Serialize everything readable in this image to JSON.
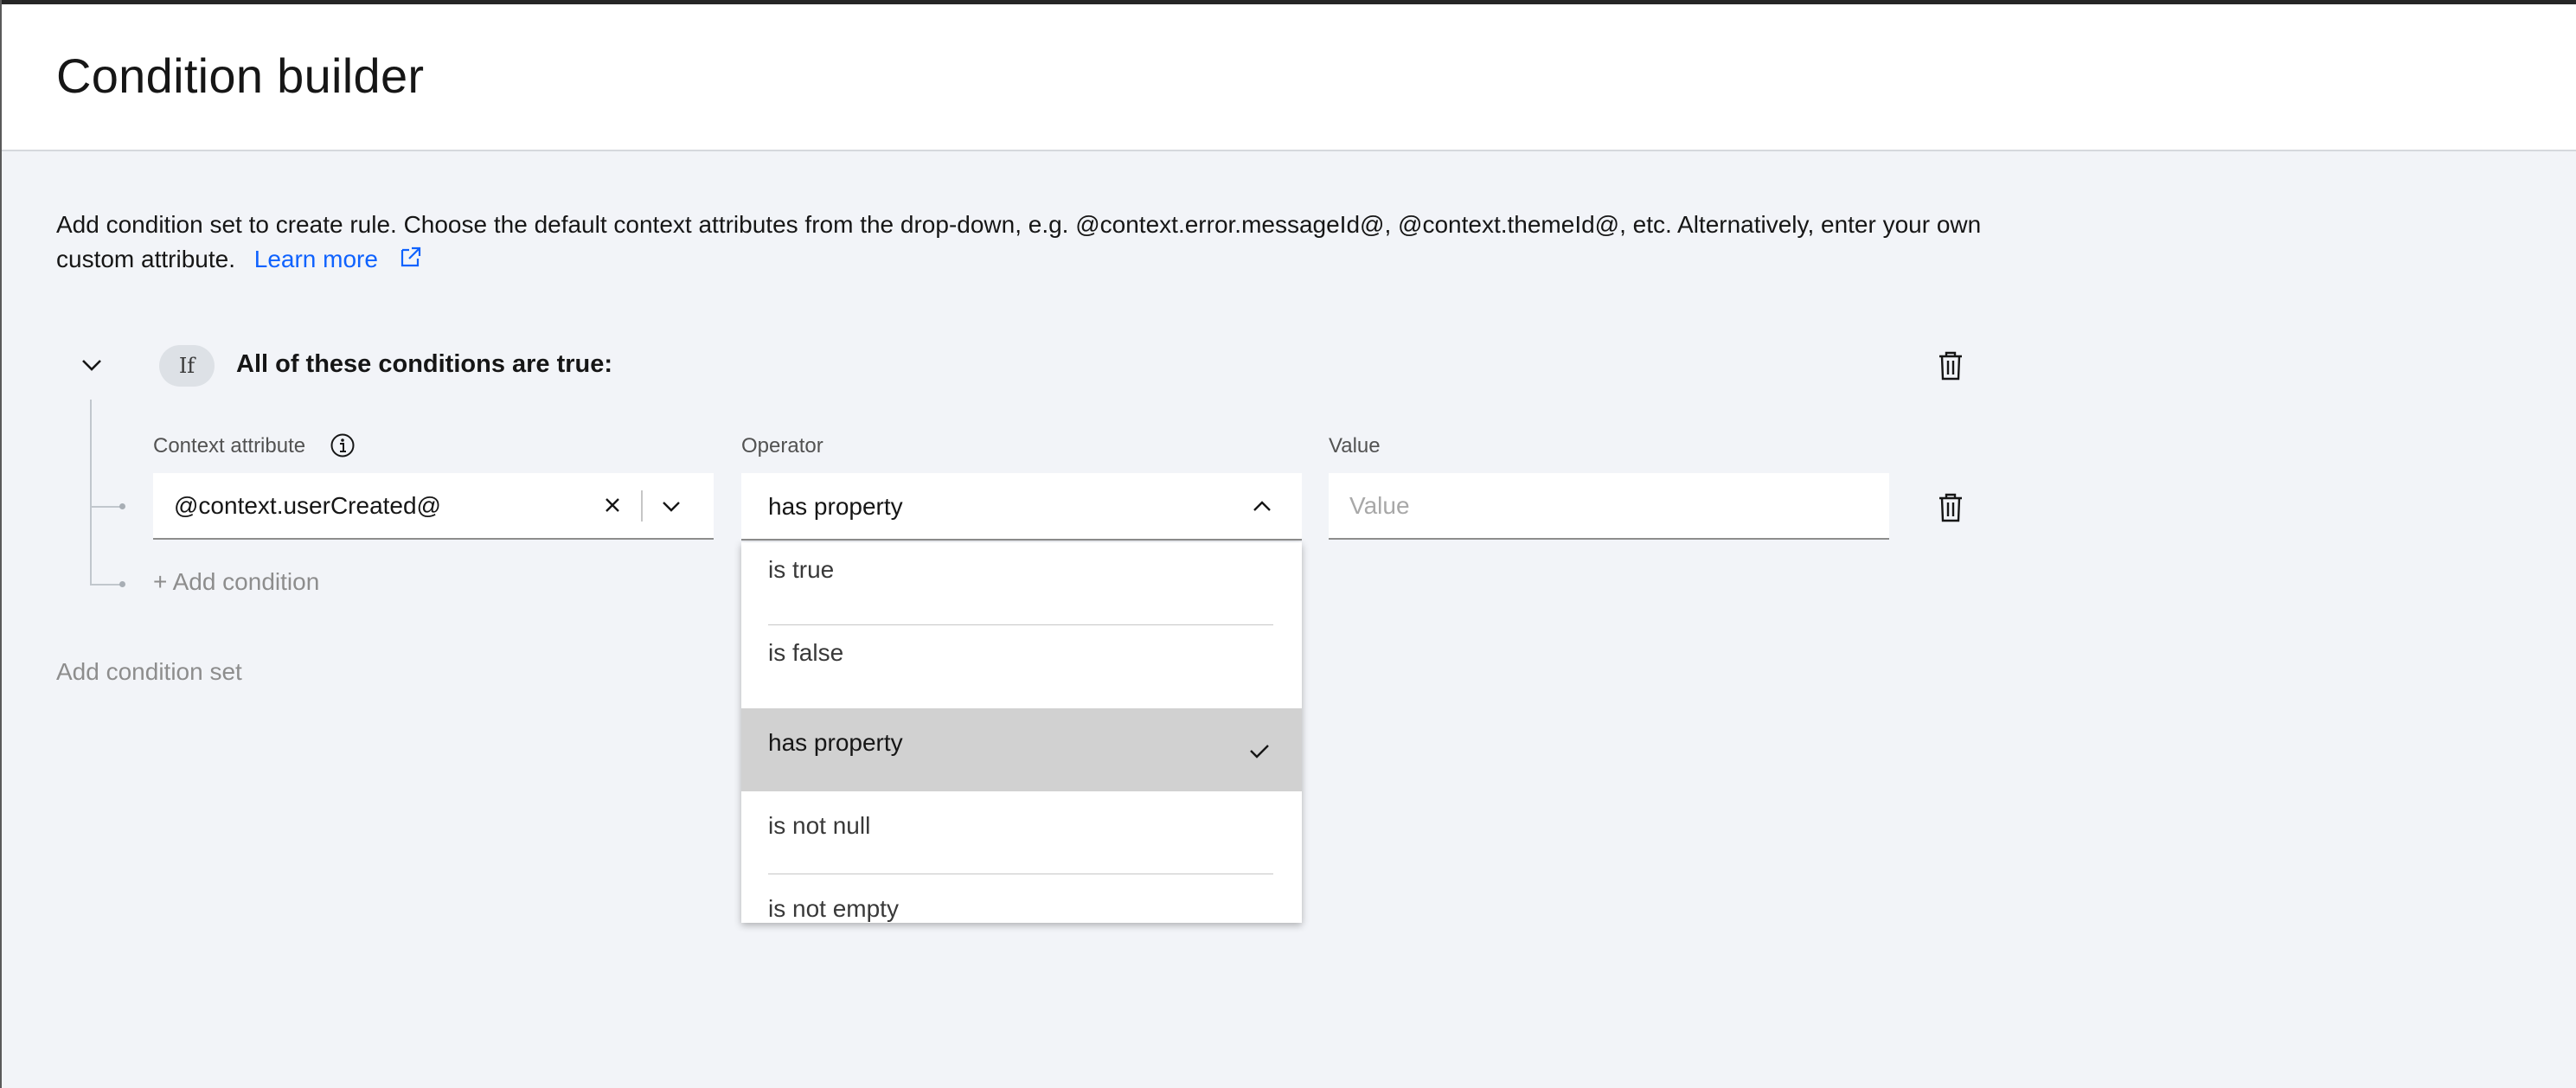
{
  "page": {
    "title": "Condition builder",
    "description": "Add condition set to create rule. Choose the default context attributes from the drop-down, e.g. @context.error.messageId@, @context.themeId@, etc. Alternatively, enter your own custom attribute.",
    "learn_more_label": "Learn more"
  },
  "condition_set": {
    "if_tag": "If",
    "title": "All of these conditions are true:",
    "fields": {
      "context_attribute_label": "Context attribute",
      "operator_label": "Operator",
      "value_label": "Value"
    },
    "condition": {
      "context_attribute_value": "@context.userCreated@",
      "operator_value": "has property",
      "value_placeholder": "Value",
      "value": ""
    },
    "add_condition_label": "+ Add condition"
  },
  "add_condition_set_label": "Add condition set",
  "operator_menu": {
    "items": [
      {
        "label": "is true",
        "selected": false
      },
      {
        "label": "is false",
        "selected": false
      },
      {
        "label": "has property",
        "selected": true
      },
      {
        "label": "is not null",
        "selected": false
      },
      {
        "label": "is not empty",
        "selected": false
      }
    ]
  },
  "icons": {
    "collapse": "chevron-down-icon",
    "info": "information-icon",
    "clear": "close-icon",
    "external_link": "launch-icon",
    "delete": "trash-can-icon",
    "dropdown_open": "chevron-up-icon",
    "selected": "checkmark-icon"
  },
  "colors": {
    "link": "#0f62fe",
    "background": "#f2f4f8",
    "selected_menu_item": "#d1d1d1"
  }
}
